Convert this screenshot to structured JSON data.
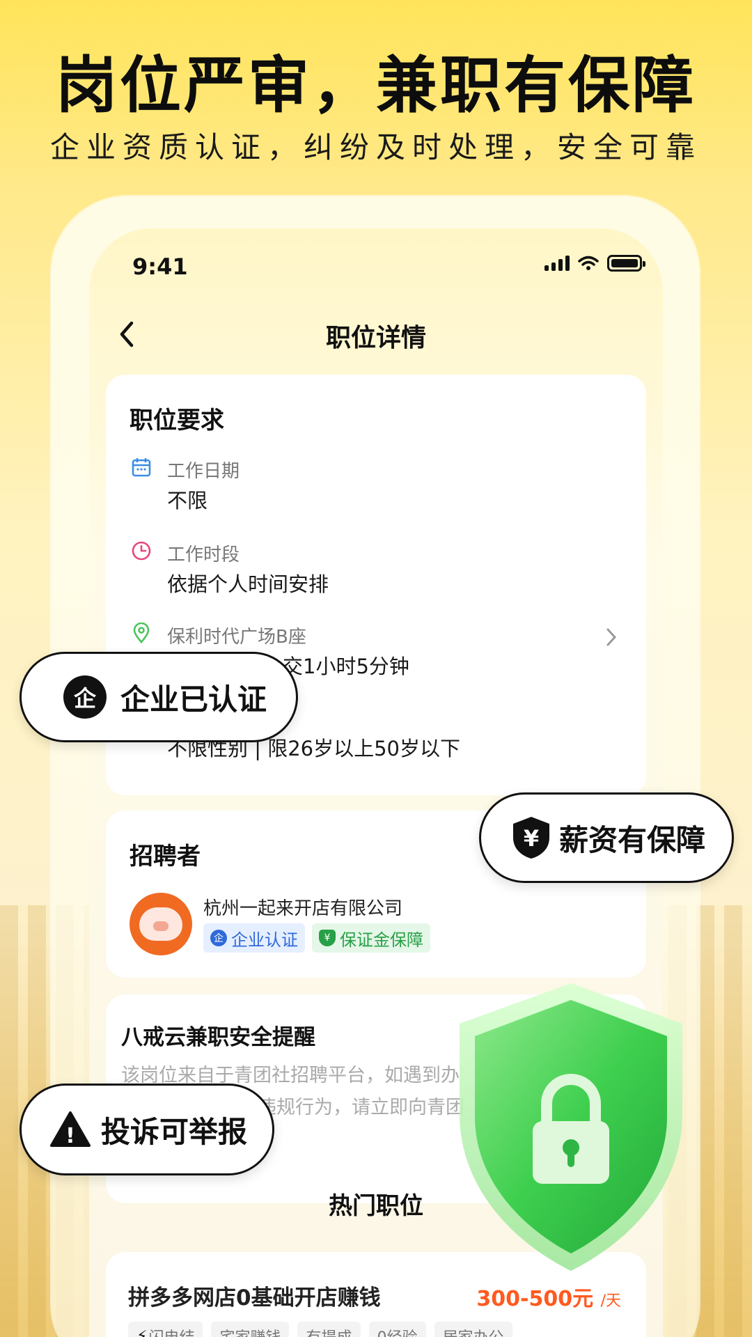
{
  "promo": {
    "headline": "岗位严审，兼职有保障",
    "subline": "企业资质认证，纠纷及时处理，安全可靠"
  },
  "status_bar": {
    "time": "9:41"
  },
  "nav": {
    "back_icon": "chevron-left-icon",
    "title": "职位详情"
  },
  "requirements": {
    "title": "职位要求",
    "items": [
      {
        "icon": "calendar-icon",
        "label": "工作日期",
        "value": "不限"
      },
      {
        "icon": "clock-icon",
        "label": "工作时段",
        "value": "依据个人时间安排"
      },
      {
        "icon": "location-pin-icon",
        "label": "保利时代广场B座",
        "value": "交1小时5分钟"
      },
      {
        "icon": "person-icon",
        "label": "",
        "value": "不限性别 | 限26岁以上50岁以下"
      }
    ]
  },
  "recruiter": {
    "title": "招聘者",
    "company": "杭州一起来开店有限公司",
    "badges": [
      {
        "label": "企业认证",
        "glyph": "企",
        "color": "#2f6ad9"
      },
      {
        "label": "保证金保障",
        "glyph": "¥",
        "color": "#27a047"
      }
    ]
  },
  "safety": {
    "title": "八戒云兼职安全提醒",
    "line1": "该岗位来自于青团社招聘平台，如遇到办",
    "line2": "违规行为，请立即向青团"
  },
  "hot_jobs": {
    "title": "热门职位",
    "carousel_total": 5,
    "carousel_active": 5,
    "job": {
      "name": "拼多多网店0基础开店赚钱",
      "pay": "300-500元",
      "unit": "/天",
      "tags": [
        "闪电结",
        "宅家赚钱",
        "有提成",
        "0经验",
        "居家办公"
      ]
    }
  },
  "callouts": {
    "verified": {
      "glyph": "企",
      "label": "企业已认证"
    },
    "salary": {
      "glyph": "¥",
      "label": "薪资有保障"
    },
    "report": {
      "glyph": "!",
      "label": "投诉可举报"
    }
  },
  "colors": {
    "accent_yellow": "#ffd83a",
    "pay_orange": "#ff5a1f",
    "shield_green": "#3fcf4f"
  }
}
